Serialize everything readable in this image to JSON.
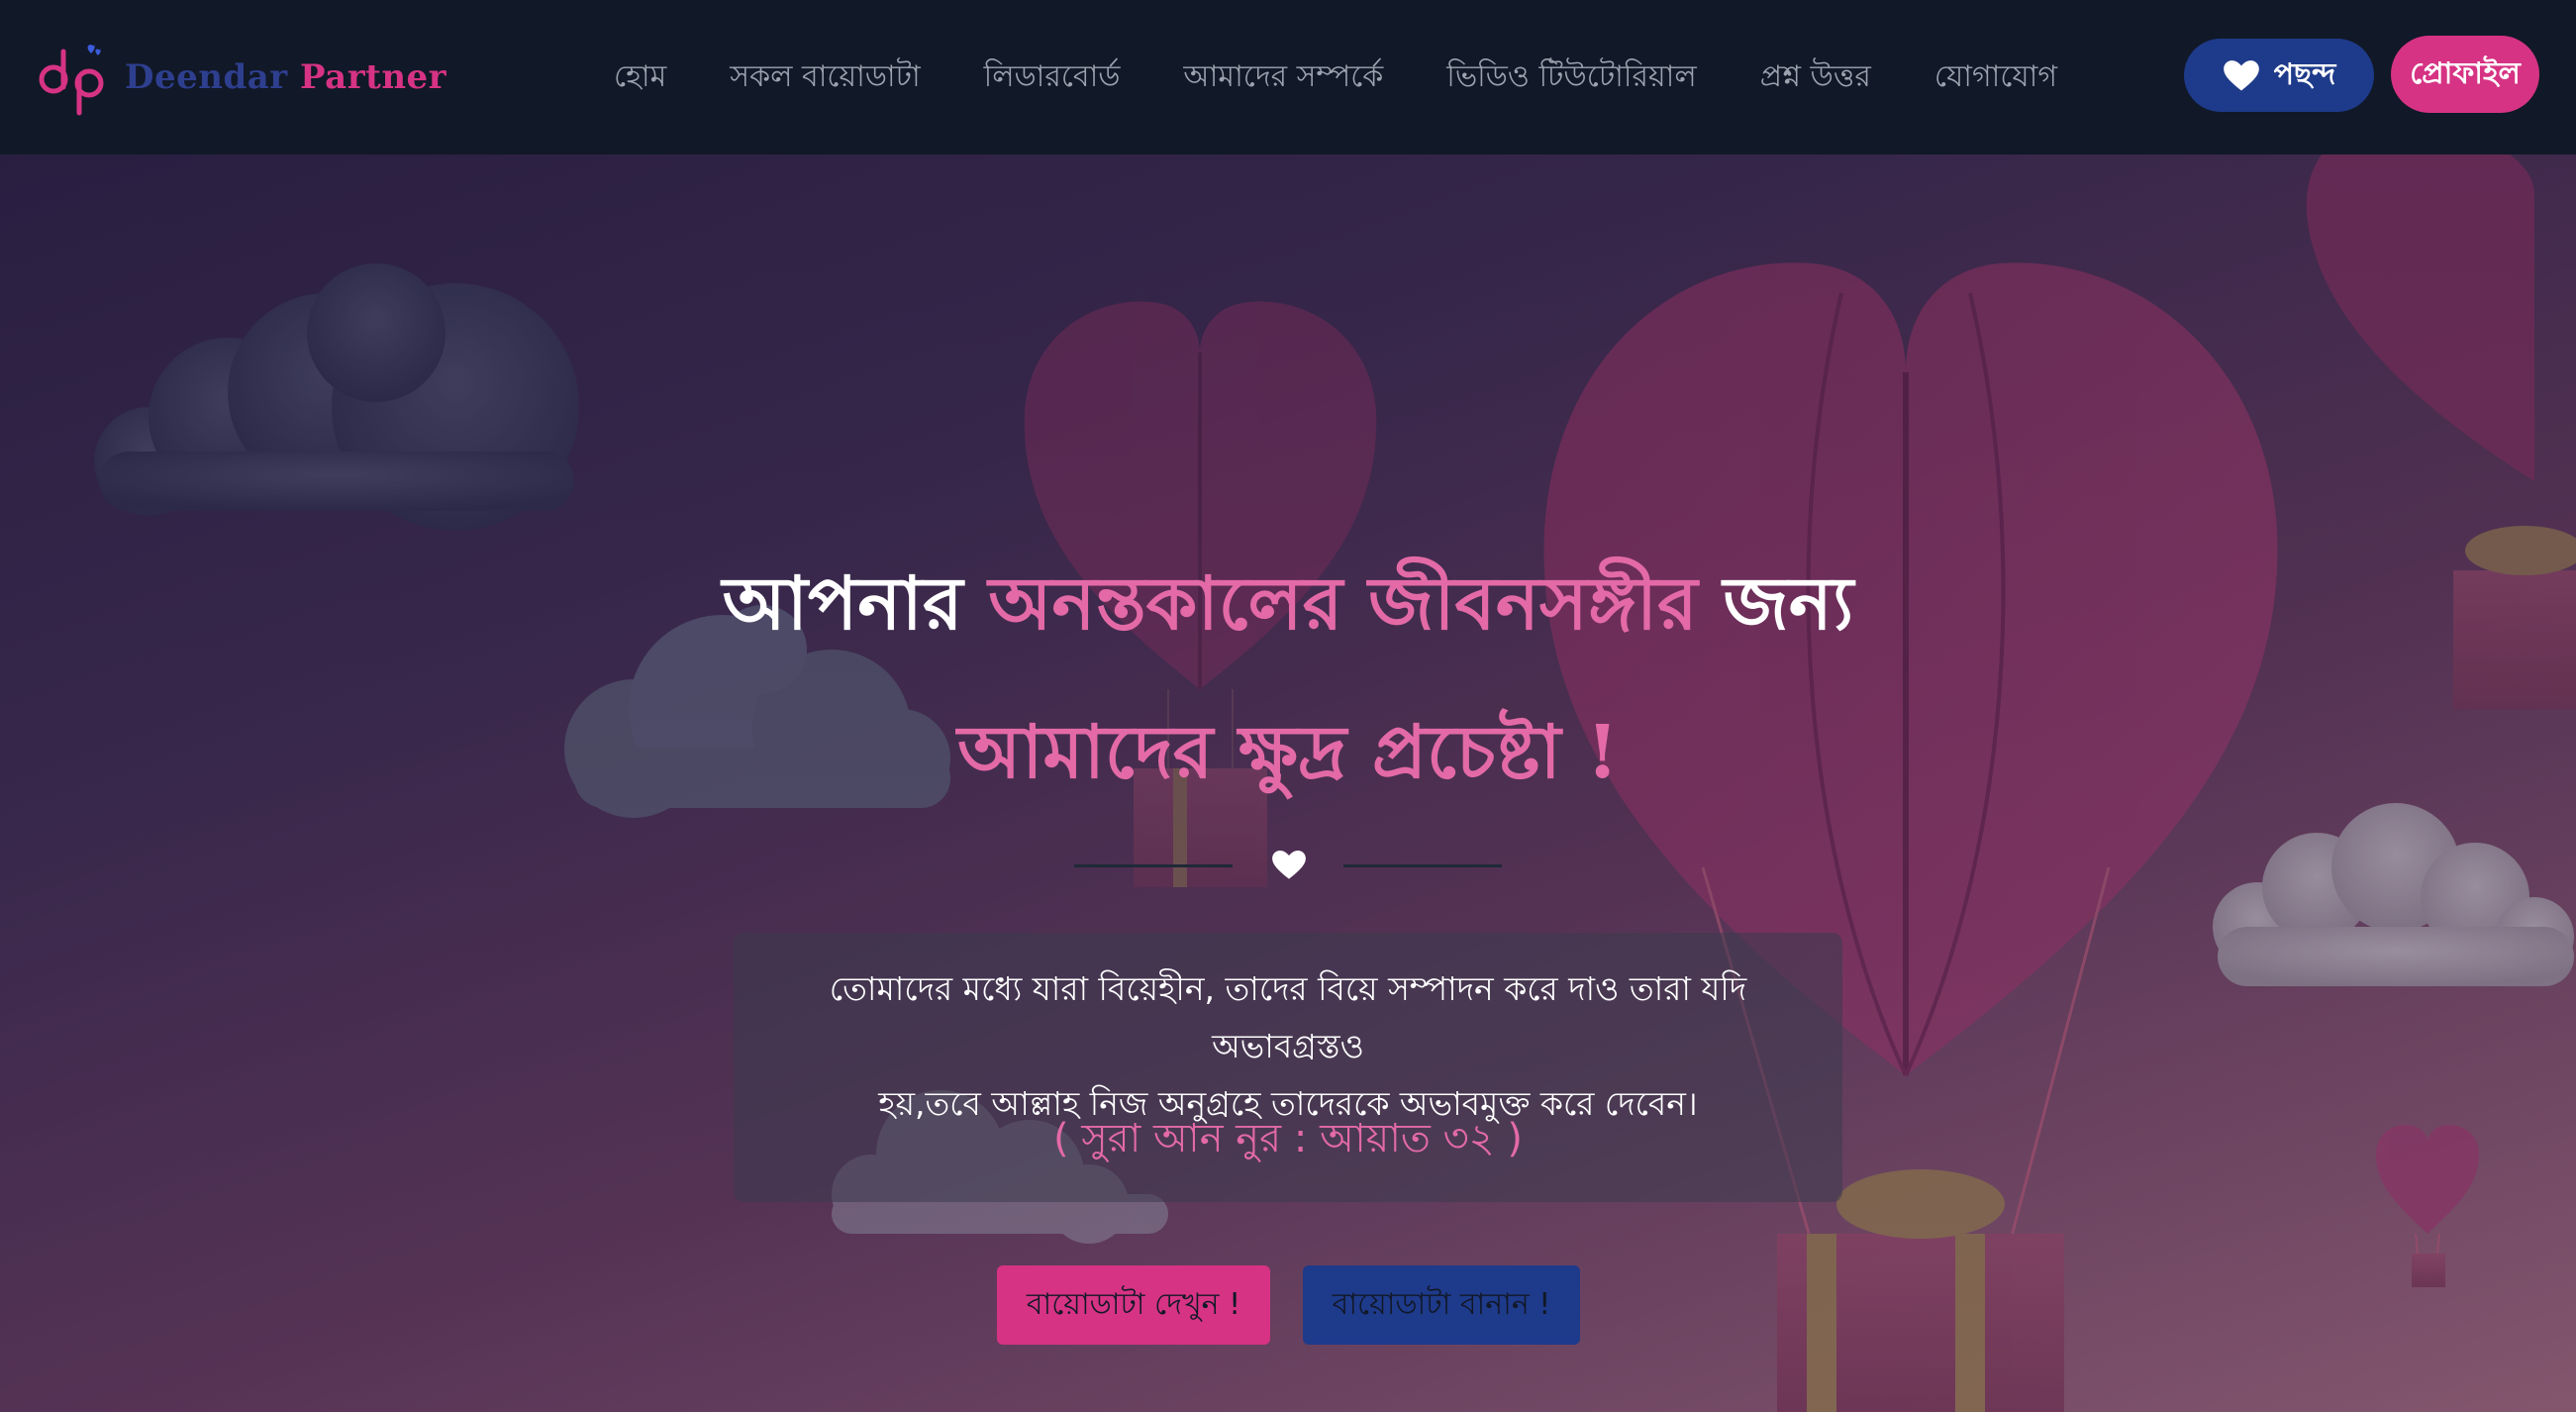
{
  "brand": {
    "logo_word1": "Deendar",
    "logo_word2": "Partner",
    "primary_pink": "#d63384",
    "primary_blue": "#1e3a8a"
  },
  "nav": {
    "items": [
      {
        "label": "হোম"
      },
      {
        "label": "সকল বায়োডাটা"
      },
      {
        "label": "লিডারবোর্ড"
      },
      {
        "label": "আমাদের সম্পর্কে"
      },
      {
        "label": "ভিডিও টিউটোরিয়াল"
      },
      {
        "label": "প্রশ্ন উত্তর"
      },
      {
        "label": "যোগাযোগ"
      }
    ],
    "like_button": "পছন্দ",
    "profile_button": "প্রোফাইল"
  },
  "hero": {
    "line1": {
      "part1": "আপনার ",
      "part2": "অনন্তকালের",
      "part3": " ",
      "part4": "জীবনসঙ্গীর",
      "part5": " জন্য"
    },
    "line2": {
      "part1": "আমাদের ",
      "part2": "ক্ষুদ্র",
      "part3": " প্রচেষ্টা !"
    },
    "quote": {
      "line1": "তোমাদের মধ্যে যারা বিয়েহীন, তাদের বিয়ে সম্পাদন করে দাও তারা যদি অভাবগ্রস্তও",
      "line2": "হয়,তবে আল্লাহ নিজ অনুগ্রহে তাদেরকে অভাবমুক্ত করে দেবেন।",
      "reference": "( সুরা আন নুর : আয়াত ৩২ )"
    },
    "view_biodata_button": "বায়োডাটা দেখুন !",
    "make_biodata_button": "বায়োডাটা বানান !"
  },
  "icons": {
    "heart": "heart-icon",
    "logo_mark": "dp-logo-icon"
  }
}
